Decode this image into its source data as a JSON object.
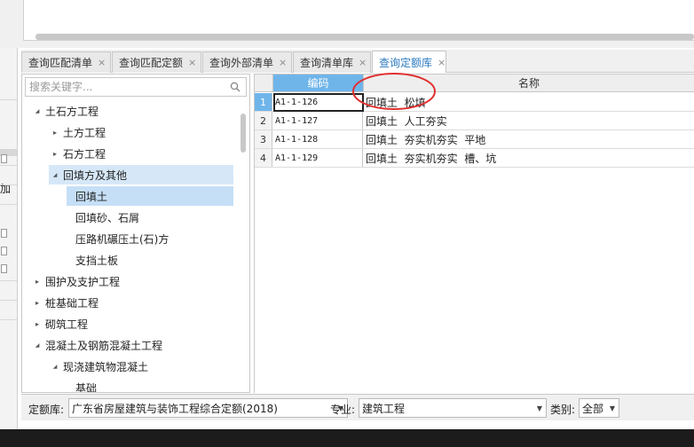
{
  "tabs": [
    {
      "label": "查询匹配清单",
      "active": false
    },
    {
      "label": "查询匹配定额",
      "active": false
    },
    {
      "label": "查询外部清单",
      "active": false
    },
    {
      "label": "查询清单库",
      "active": false
    },
    {
      "label": "查询定额库",
      "active": true
    }
  ],
  "tab_close_glyph": "×",
  "left_strip_text": "加",
  "search": {
    "placeholder": "搜索关键字..."
  },
  "tree": [
    {
      "label": "土石方工程",
      "level": 0,
      "expanded": true,
      "has_children": true
    },
    {
      "label": "土方工程",
      "level": 1,
      "expanded": false,
      "has_children": true
    },
    {
      "label": "石方工程",
      "level": 1,
      "expanded": false,
      "has_children": true
    },
    {
      "label": "回填方及其他",
      "level": 1,
      "expanded": true,
      "has_children": true,
      "highlighted": true
    },
    {
      "label": "回填土",
      "level": 2,
      "has_children": false,
      "selected": true
    },
    {
      "label": "回填砂、石屑",
      "level": 2,
      "has_children": false
    },
    {
      "label": "压路机碾压土(石)方",
      "level": 2,
      "has_children": false
    },
    {
      "label": "支挡土板",
      "level": 2,
      "has_children": false
    },
    {
      "label": "围护及支护工程",
      "level": 0,
      "expanded": false,
      "has_children": true
    },
    {
      "label": "桩基础工程",
      "level": 0,
      "expanded": false,
      "has_children": true
    },
    {
      "label": "砌筑工程",
      "level": 0,
      "expanded": false,
      "has_children": true
    },
    {
      "label": "混凝土及钢筋混凝土工程",
      "level": 0,
      "expanded": true,
      "has_children": true
    },
    {
      "label": "现浇建筑物混凝土",
      "level": 1,
      "expanded": true,
      "has_children": true
    },
    {
      "label": "基础",
      "level": 2,
      "has_children": false
    }
  ],
  "grid": {
    "columns": [
      "编码",
      "名称"
    ],
    "rows": [
      {
        "num": "1",
        "code": "A1-1-126",
        "name": "回填土  松填",
        "selected": true
      },
      {
        "num": "2",
        "code": "A1-1-127",
        "name": "回填土  人工夯实"
      },
      {
        "num": "3",
        "code": "A1-1-128",
        "name": "回填土  夯实机夯实  平地"
      },
      {
        "num": "4",
        "code": "A1-1-129",
        "name": "回填土  夯实机夯实  槽、坑"
      }
    ]
  },
  "filters": {
    "quota_lib_label": "定额库:",
    "quota_lib_value": "广东省房屋建筑与装饰工程综合定额(2018)",
    "specialty_label": "专业:",
    "specialty_value": "建筑工程",
    "category_label": "类别:",
    "category_value": "全部"
  },
  "colors": {
    "accent": "#2a7ac0",
    "header_active": "#6fb5ea",
    "tree_selected": "#c5dff6",
    "annotation": "#e03030"
  },
  "icons": {
    "search": "search-icon",
    "close": "close-icon",
    "dropdown": "chevron-down-icon"
  }
}
